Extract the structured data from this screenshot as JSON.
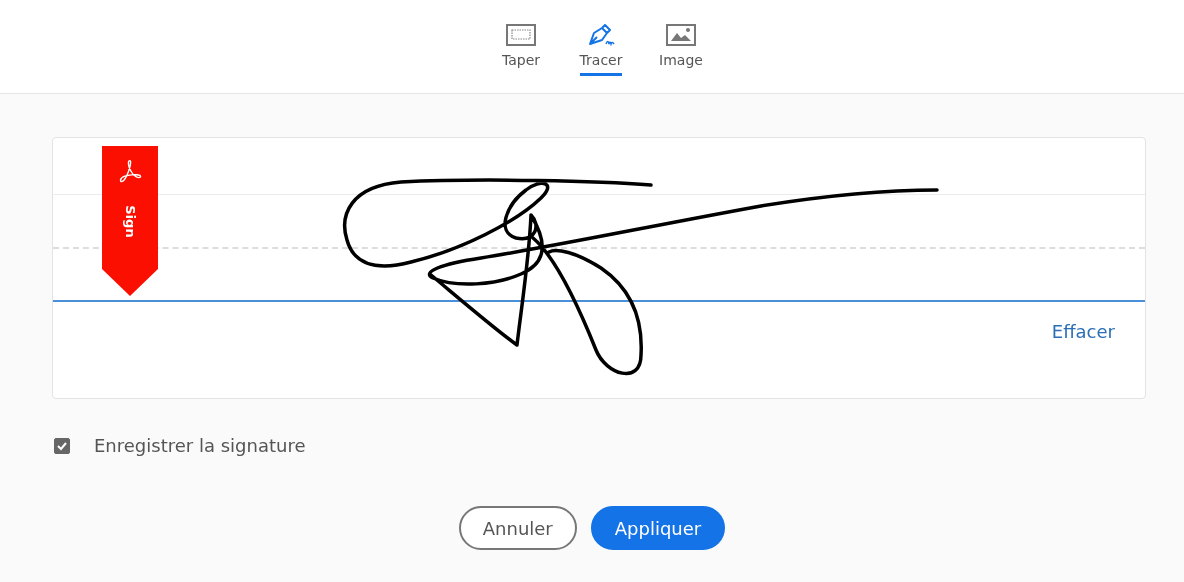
{
  "tabs": [
    {
      "label": "Taper",
      "kind": "keyboard",
      "selected": false
    },
    {
      "label": "Tracer",
      "kind": "pen",
      "selected": true
    },
    {
      "label": "Image",
      "kind": "image",
      "selected": false
    }
  ],
  "pad": {
    "ribbon_label": "Sign",
    "clear_link": "Effacer"
  },
  "save_signature": {
    "label": "Enregistrer la signature",
    "checked": true
  },
  "buttons": [
    {
      "label": "Annuler",
      "kind": "secondary"
    },
    {
      "label": "Appliquer",
      "kind": "primary"
    }
  ]
}
